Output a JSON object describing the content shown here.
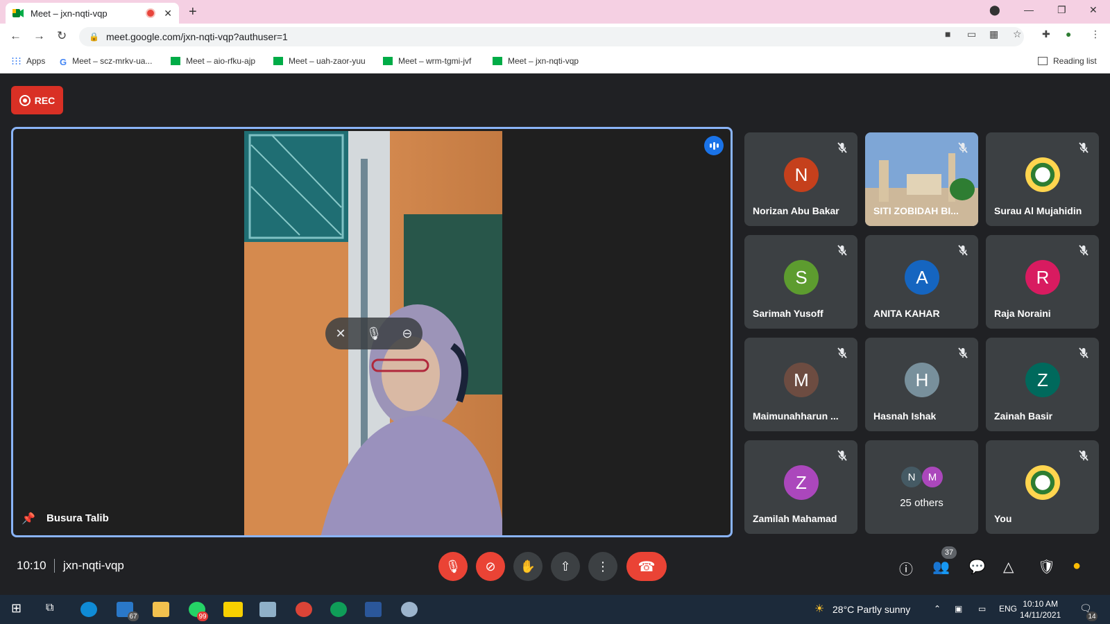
{
  "browser": {
    "tab_title": "Meet – jxn-nqti-vqp",
    "url": "meet.google.com/jxn-nqti-vqp?authuser=1",
    "bookmarks": [
      "Apps",
      "Meet – scz-mrkv-ua...",
      "Meet – aio-rfku-ajp",
      "Meet – uah-zaor-yuu",
      "Meet – wrm-tgmi-jvf",
      "Meet – jxn-nqti-vqp"
    ],
    "reading_list": "Reading list"
  },
  "meet": {
    "rec_label": "REC",
    "main_participant": "Busura Talib",
    "participants": [
      {
        "name": "Norizan Abu Bakar",
        "initial": "N",
        "color": "#c5401c"
      },
      {
        "name": "SITI ZOBIDAH BI...",
        "initial": "",
        "color": "#6b8fb8"
      },
      {
        "name": "Surau Al Mujahidin",
        "initial": "",
        "color": ""
      },
      {
        "name": "Sarimah Yusoff",
        "initial": "S",
        "color": "#5d9c2f"
      },
      {
        "name": "ANITA KAHAR",
        "initial": "A",
        "color": "#1565c0"
      },
      {
        "name": "Raja Noraini",
        "initial": "R",
        "color": "#d81b60"
      },
      {
        "name": "Maimunahharun ...",
        "initial": "M",
        "color": "#6d4c41"
      },
      {
        "name": "Hasnah Ishak",
        "initial": "H",
        "color": "#78909c"
      },
      {
        "name": "Zainah Basir",
        "initial": "Z",
        "color": "#00695c"
      },
      {
        "name": "Zamilah Mahamad",
        "initial": "Z",
        "color": "#ab47bc"
      }
    ],
    "others": {
      "label": "25 others",
      "initials": [
        "N",
        "M"
      ]
    },
    "you_label": "You",
    "time": "10:10",
    "meeting_code": "jxn-nqti-vqp",
    "participant_count": "37"
  },
  "taskbar": {
    "mail_badge": "67",
    "whatsapp_badge": "99",
    "weather": "28°C  Partly sunny",
    "lang": "ENG",
    "time": "10:10 AM",
    "date": "14/11/2021",
    "notif_badge": "14"
  }
}
